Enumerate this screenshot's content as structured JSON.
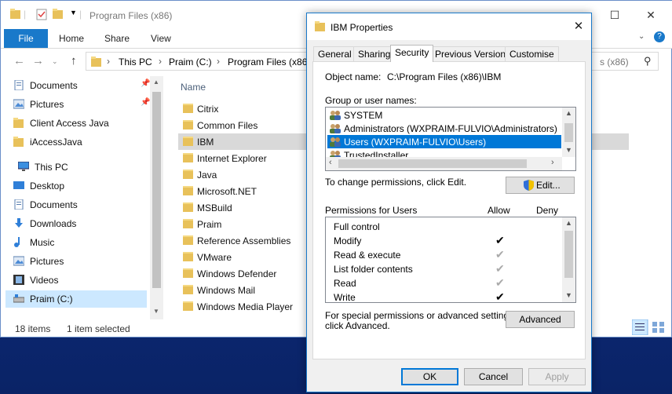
{
  "explorer": {
    "title": "Program Files (x86)",
    "ribbon_tabs": [
      "File",
      "Home",
      "Share",
      "View"
    ],
    "breadcrumb": [
      "This PC",
      "Praim (C:)",
      "Program Files (x86)"
    ],
    "search_fragment": "s (x86)",
    "column_header": "Name",
    "nav_items": [
      {
        "label": "Documents",
        "icon": "documents-icon",
        "pinned": true
      },
      {
        "label": "Pictures",
        "icon": "pictures-icon",
        "pinned": true
      },
      {
        "label": "Client Access Java",
        "icon": "folder-icon",
        "pinned": false
      },
      {
        "label": "iAccessJava",
        "icon": "folder-icon",
        "pinned": false
      },
      {
        "label": "This PC",
        "icon": "computer-icon",
        "pinned": false
      },
      {
        "label": "Desktop",
        "icon": "desktop-icon",
        "pinned": false
      },
      {
        "label": "Documents",
        "icon": "documents-icon",
        "pinned": false
      },
      {
        "label": "Downloads",
        "icon": "downloads-icon",
        "pinned": false
      },
      {
        "label": "Music",
        "icon": "music-icon",
        "pinned": false
      },
      {
        "label": "Pictures",
        "icon": "pictures-icon",
        "pinned": false
      },
      {
        "label": "Videos",
        "icon": "videos-icon",
        "pinned": false
      },
      {
        "label": "Praim (C:)",
        "icon": "drive-icon",
        "pinned": false
      }
    ],
    "files": [
      "Citrix",
      "Common Files",
      "IBM",
      "Internet Explorer",
      "Java",
      "Microsoft.NET",
      "MSBuild",
      "Praim",
      "Reference Assemblies",
      "VMware",
      "Windows Defender",
      "Windows Mail",
      "Windows Media Player"
    ],
    "selected_file": "IBM",
    "status_count": "18 items",
    "status_selected": "1 item selected"
  },
  "dialog": {
    "title": "IBM Properties",
    "tabs": [
      "General",
      "Sharing",
      "Security",
      "Previous Versions",
      "Customise"
    ],
    "active_tab": "Security",
    "object_name_label": "Object name:",
    "object_name_value": "C:\\Program Files (x86)\\IBM",
    "group_label": "Group or user names:",
    "groups": [
      {
        "label": "SYSTEM",
        "selected": false
      },
      {
        "label": "Administrators (WXPRAIM-FULVIO\\Administrators)",
        "selected": false
      },
      {
        "label": "Users (WXPRAIM-FULVIO\\Users)",
        "selected": true
      },
      {
        "label": "TrustedInstaller",
        "selected": false
      }
    ],
    "change_hint": "To change permissions, click Edit.",
    "edit_button": "Edit...",
    "permissions_label": "Permissions for Users",
    "allow_header": "Allow",
    "deny_header": "Deny",
    "permissions": [
      {
        "name": "Full control",
        "allow": "none"
      },
      {
        "name": "Modify",
        "allow": "checked"
      },
      {
        "name": "Read & execute",
        "allow": "inherited"
      },
      {
        "name": "List folder contents",
        "allow": "inherited"
      },
      {
        "name": "Read",
        "allow": "inherited"
      },
      {
        "name": "Write",
        "allow": "checked"
      }
    ],
    "special_hint_1": "For special permissions or advanced settings,",
    "special_hint_2": "click Advanced.",
    "advanced_button": "Advanced",
    "ok_button": "OK",
    "cancel_button": "Cancel",
    "apply_button": "Apply"
  },
  "colors": {
    "accent": "#1979ca",
    "selection": "#0078d7",
    "folder": "#e8c15a"
  }
}
